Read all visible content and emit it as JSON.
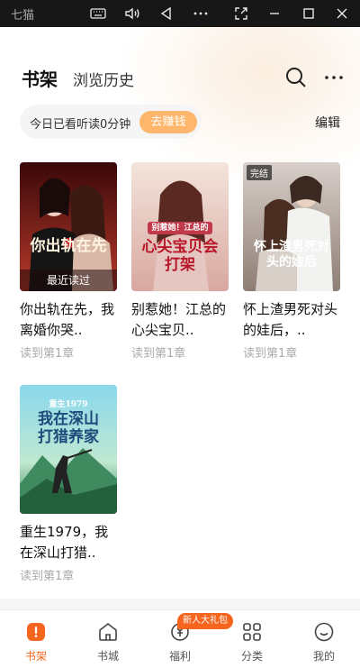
{
  "window": {
    "app_label": "七猫",
    "controls": [
      "keyboard-icon",
      "volume-icon",
      "back-icon",
      "more-icon",
      "screenshot-icon",
      "minimize-icon",
      "maximize-icon",
      "close-icon"
    ]
  },
  "header": {
    "active_tab": "书架",
    "other_tab": "浏览历史",
    "icons": [
      "search-icon",
      "more-icon"
    ]
  },
  "reading_stat": {
    "text": "今日已看听读0分钟",
    "earn_button": "去赚钱"
  },
  "edit_label": "编辑",
  "books": [
    {
      "title": "你出轨在先，我离婚你哭..",
      "progress": "读到第1章",
      "cover_text": "你出轨在先",
      "cover_overlay": "最近读过",
      "cover_colors": [
        "#6b1414",
        "#c24a3a"
      ]
    },
    {
      "title": "别惹她！江总的心尖宝贝..",
      "progress": "读到第1章",
      "cover_text": "心尖宝贝会打架",
      "cover_sub": "别惹她！江总的",
      "cover_colors": [
        "#e8c8b8",
        "#f4e2d8"
      ]
    },
    {
      "title": "怀上渣男死对头的娃后，..",
      "progress": "读到第1章",
      "cover_text": "怀上渣男死对头的娃后",
      "badge": "完结",
      "cover_colors": [
        "#a8968a",
        "#d9cfc8"
      ]
    },
    {
      "title": "重生1979，我在深山打猎..",
      "progress": "读到第1章",
      "cover_text": "我在深山打猎养家",
      "cover_sub": "重生1979",
      "cover_colors": [
        "#6fc8e0",
        "#3c8a5a"
      ]
    }
  ],
  "bottom_nav": {
    "items": [
      {
        "label": "书架",
        "icon": "bookshelf-icon",
        "active": true
      },
      {
        "label": "书城",
        "icon": "bookstore-icon",
        "active": false
      },
      {
        "label": "福利",
        "icon": "welfare-icon",
        "active": false
      },
      {
        "label": "分类",
        "icon": "category-icon",
        "active": false
      },
      {
        "label": "我的",
        "icon": "profile-icon",
        "active": false
      }
    ],
    "promo_badge": "新人大礼包"
  },
  "colors": {
    "accent": "#f5651e",
    "earn_button": "#fdb66c"
  }
}
